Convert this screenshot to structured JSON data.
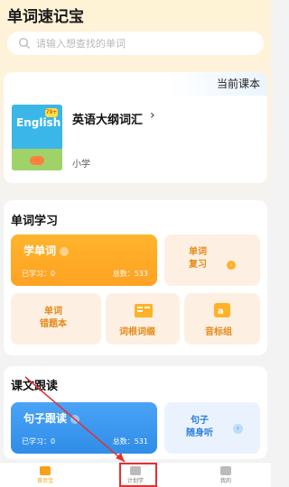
{
  "app_title": "单词速记宝",
  "search": {
    "placeholder": "请输入想查找的单词"
  },
  "current_book": {
    "label": "当前课本",
    "name": "英语大纲词汇",
    "level": "小学",
    "cover_text": "English",
    "cover_badge": "79+"
  },
  "word_study": {
    "title": "单词学习",
    "learn_words": {
      "label": "学单词",
      "learned_label": "已学习：0",
      "total_label": "总数：533"
    },
    "review": {
      "line1": "单词",
      "line2": "复习"
    },
    "wrong_book": {
      "line1": "单词",
      "line2": "错题本"
    },
    "root_affix": {
      "label": "词根词缀"
    },
    "phonetic": {
      "label": "音标组"
    }
  },
  "text_follow": {
    "title": "课文跟读",
    "sentence_follow": {
      "label": "句子跟读",
      "learned_label": "已学习：0",
      "total_label": "总数：531"
    },
    "sentence_listen": {
      "line1": "句子",
      "line2": "随身听"
    }
  },
  "tabs": [
    {
      "label": "首页宝"
    },
    {
      "label": "计划学"
    },
    {
      "label": "我的"
    }
  ],
  "colors": {
    "accent": "#ffa223",
    "blue": "#2f8de8",
    "highlight_box": "#e53030"
  }
}
